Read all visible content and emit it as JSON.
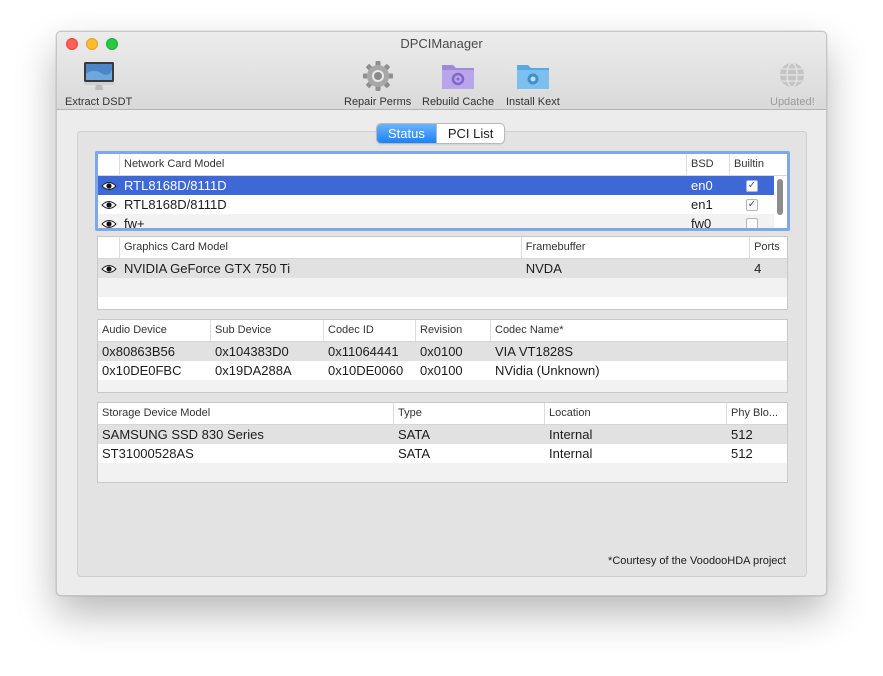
{
  "window": {
    "title": "DPCIManager"
  },
  "toolbar": {
    "extract_dsdt": "Extract DSDT",
    "repair_perms": "Repair Perms",
    "rebuild_cache": "Rebuild Cache",
    "install_kext": "Install Kext",
    "updated": "Updated!"
  },
  "tabs": [
    {
      "label": "Status",
      "active": true
    },
    {
      "label": "PCI List",
      "active": false
    }
  ],
  "network": {
    "headers": [
      "Network Card Model",
      "BSD",
      "Builtin"
    ],
    "rows": [
      {
        "model": "RTL8168D/8111D",
        "bsd": "en0",
        "builtin": true
      },
      {
        "model": "RTL8168D/8111D",
        "bsd": "en1",
        "builtin": true
      },
      {
        "model": "fw+",
        "bsd": "fw0",
        "builtin": false
      }
    ]
  },
  "graphics": {
    "headers": [
      "Graphics Card Model",
      "Framebuffer",
      "Ports"
    ],
    "rows": [
      {
        "model": "NVIDIA GeForce GTX 750 Ti",
        "framebuffer": "NVDA",
        "ports": "4"
      }
    ]
  },
  "audio": {
    "headers": [
      "Audio Device",
      "Sub Device",
      "Codec ID",
      "Revision",
      "Codec Name*"
    ],
    "rows": [
      {
        "device": "0x80863B56",
        "sub": "0x104383D0",
        "codec": "0x11064441",
        "rev": "0x0100",
        "name": "VIA VT1828S"
      },
      {
        "device": "0x10DE0FBC",
        "sub": "0x19DA288A",
        "codec": "0x10DE0060",
        "rev": "0x0100",
        "name": "NVidia (Unknown)"
      }
    ]
  },
  "storage": {
    "headers": [
      "Storage Device Model",
      "Type",
      "Location",
      "Phy Blo..."
    ],
    "rows": [
      {
        "model": "SAMSUNG SSD 830 Series",
        "type": "SATA",
        "location": "Internal",
        "block": "512"
      },
      {
        "model": "ST31000528AS",
        "type": "SATA",
        "location": "Internal",
        "block": "512"
      }
    ]
  },
  "footnote": "*Courtesy of the VoodooHDA project",
  "colors": {
    "selection": "#3d68d6",
    "accent": "#1a82fb",
    "focus_ring": "#7ea8e8"
  }
}
